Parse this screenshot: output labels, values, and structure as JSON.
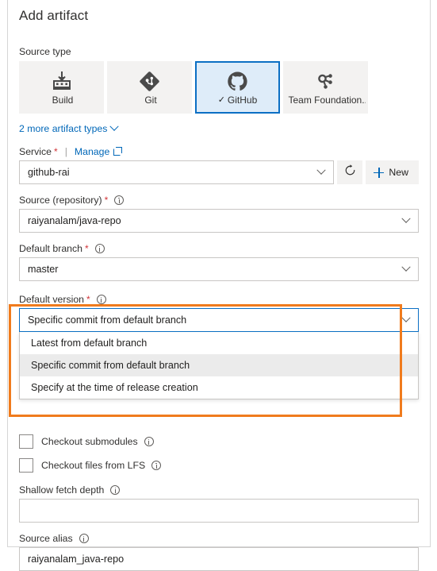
{
  "dialog": {
    "title": "Add artifact"
  },
  "source_type": {
    "label": "Source type",
    "tiles": [
      {
        "label": "Build",
        "icon": "build-icon",
        "selected": false,
        "check": ""
      },
      {
        "label": "Git",
        "icon": "git-icon",
        "selected": false,
        "check": ""
      },
      {
        "label": "GitHub",
        "icon": "github-icon",
        "selected": true,
        "check": "✓"
      },
      {
        "label": "Team Foundation...",
        "icon": "team-foundation-icon",
        "selected": false,
        "check": ""
      }
    ],
    "more_link": "2 more artifact types"
  },
  "service": {
    "label": "Service",
    "required_marker": "*",
    "separator": "|",
    "manage_label": "Manage",
    "value": "github-rai",
    "refresh_title": "Refresh",
    "new_label": "New"
  },
  "source_repository": {
    "label": "Source (repository)",
    "required_marker": "*",
    "value": "raiyanalam/java-repo"
  },
  "default_branch": {
    "label": "Default branch",
    "required_marker": "*",
    "value": "master"
  },
  "default_version": {
    "label": "Default version",
    "required_marker": "*",
    "value": "Specific commit from default branch",
    "options": [
      "Latest from default branch",
      "Specific commit from default branch",
      "Specify at the time of release creation"
    ],
    "selected_index": 1
  },
  "checkout_submodules": {
    "label": "Checkout submodules",
    "checked": false
  },
  "checkout_lfs": {
    "label": "Checkout files from LFS",
    "checked": false
  },
  "shallow_fetch_depth": {
    "label": "Shallow fetch depth",
    "value": "",
    "placeholder": ""
  },
  "source_alias": {
    "label": "Source alias",
    "value": "raiyanalam_java-repo"
  },
  "colors": {
    "highlight_orange": "#f07b1d",
    "accent_blue": "#0067b8",
    "selected_tile_bg": "#deecf9",
    "selected_tile_border": "#0b6fc4",
    "tile_bg": "#f3f2f1",
    "required_red": "#d13438"
  }
}
